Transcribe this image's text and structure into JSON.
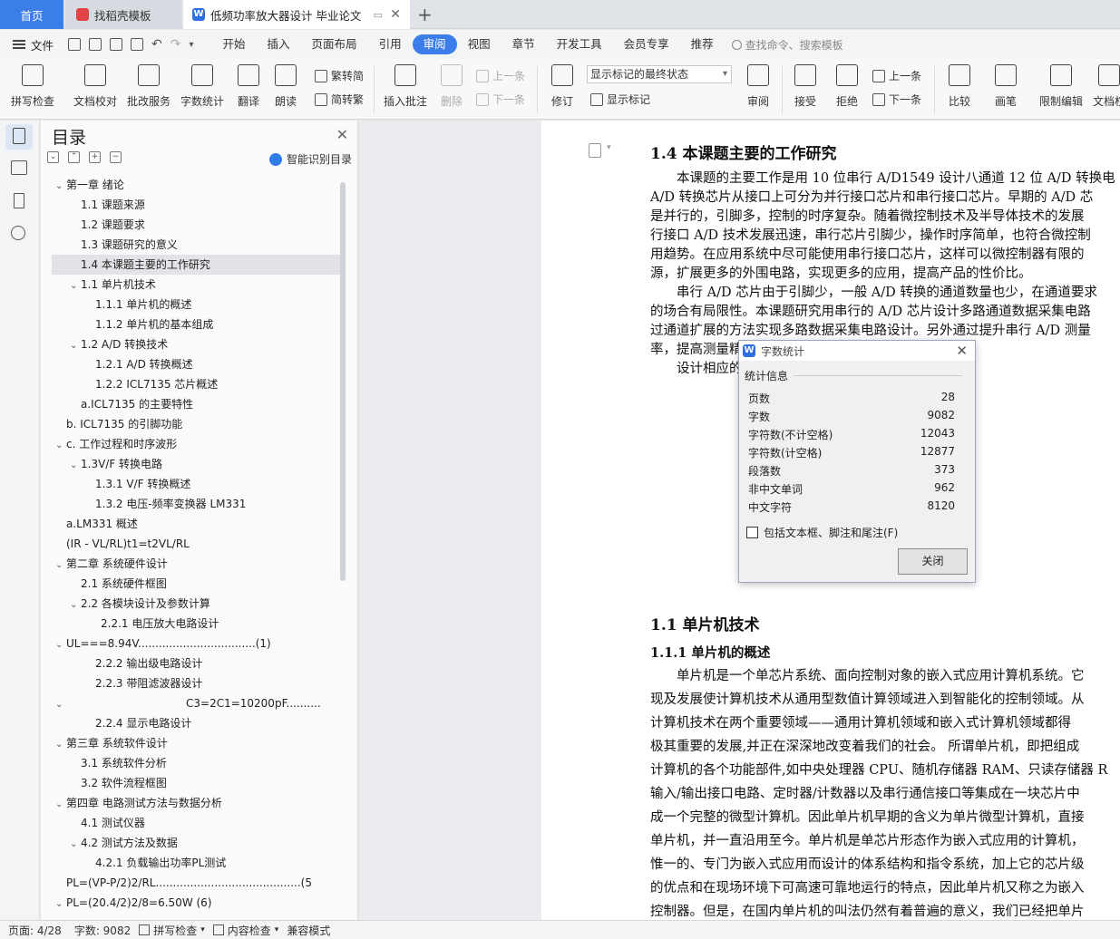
{
  "tabs": {
    "home": "首页",
    "template": "找稻壳模板",
    "doc": "低频功率放大器设计 毕业论文"
  },
  "menu": {
    "file": "文件",
    "items": [
      "开始",
      "插入",
      "页面布局",
      "引用",
      "审阅",
      "视图",
      "章节",
      "开发工具",
      "会员专享",
      "推荐"
    ],
    "active": "审阅",
    "search": "查找命令、搜索模板"
  },
  "ribbon": {
    "spell": "拼写检查",
    "doc_check": "文档校对",
    "review_service": "批改服务",
    "word_count": "字数统计",
    "translate": "翻译",
    "read": "朗读",
    "trad": "繁转简",
    "simp": "简转繁",
    "insert_comment": "插入批注",
    "delete": "删除",
    "prev": "上一条",
    "next": "下一条",
    "revise": "修订",
    "show_select": "显示标记的最终状态",
    "show_marks": "显示标记",
    "review": "审阅",
    "accept": "接受",
    "reject": "拒绝",
    "prev2": "上一条",
    "next2": "下一条",
    "compare": "比较",
    "pen": "画笔",
    "restrict": "限制编辑",
    "doc_perm": "文档权"
  },
  "toc": {
    "title": "目录",
    "smart": "智能识别目录",
    "items": [
      {
        "text": "第一章  绪论",
        "caret": "v"
      },
      {
        "text": "1.1 课题来源",
        "caret": ""
      },
      {
        "text": "1.2 课题要求",
        "caret": ""
      },
      {
        "text": "1.3 课题研究的意义",
        "caret": ""
      },
      {
        "text": "1.4 本课题主要的工作研究",
        "caret": ""
      },
      {
        "text": "1.1 单片机技术",
        "caret": "v"
      },
      {
        "text": "1.1.1 单片机的概述",
        "caret": ""
      },
      {
        "text": "1.1.2 单片机的基本组成",
        "caret": ""
      },
      {
        "text": "1.2 A/D 转换技术",
        "caret": "v"
      },
      {
        "text": "1.2.1 A/D 转换概述",
        "caret": ""
      },
      {
        "text": "1.2.2 ICL7135 芯片概述",
        "caret": ""
      },
      {
        "text": "a.ICL7135 的主要特性",
        "caret": ""
      },
      {
        "text": "b. ICL7135 的引脚功能",
        "caret": ""
      },
      {
        "text": "c.  工作过程和时序波形",
        "caret": "v"
      },
      {
        "text": "1.3V/F 转换电路",
        "caret": "v"
      },
      {
        "text": "1.3.1 V/F 转换概述",
        "caret": ""
      },
      {
        "text": "1.3.2  电压-频率变换器 LM331",
        "caret": ""
      },
      {
        "text": "a.LM331  概述",
        "caret": ""
      },
      {
        "text": "(IR - VL/RL)t1=t2VL/RL",
        "caret": ""
      },
      {
        "text": "第二章  系统硬件设计",
        "caret": "v"
      },
      {
        "text": "2.1  系统硬件框图",
        "caret": ""
      },
      {
        "text": "2.2  各模块设计及参数计算",
        "caret": "v"
      },
      {
        "text": "2.2.1  电压放大电路设计",
        "caret": ""
      },
      {
        "text": "UL===8.94V..................................(1)",
        "caret": "v"
      },
      {
        "text": "2.2.2  输出级电路设计",
        "caret": ""
      },
      {
        "text": "2.2.3  带阻滤波器设计",
        "caret": ""
      },
      {
        "text": "C3=2C1=10200pF..........",
        "caret": "v"
      },
      {
        "text": "2.2.4  显示电路设计",
        "caret": ""
      },
      {
        "text": "第三章    系统软件设计",
        "caret": "v"
      },
      {
        "text": "3.1  系统软件分析",
        "caret": ""
      },
      {
        "text": "3.2  软件流程框图",
        "caret": ""
      },
      {
        "text": "第四章    电路测试方法与数据分析",
        "caret": "v"
      },
      {
        "text": "4.1  测试仪器",
        "caret": ""
      },
      {
        "text": "4.2  测试方法及数据",
        "caret": "v"
      },
      {
        "text": "4.2.1  负载输出功率PL测试",
        "caret": ""
      },
      {
        "text": "PL=(VP-P/2)2/RL..........................................(5",
        "caret": ""
      },
      {
        "text": "PL=(20.4/2)2/8=6.50W                                (6)",
        "caret": "v"
      }
    ]
  },
  "doc": {
    "h_14": "1.4 本课题主要的工作研究",
    "p1": [
      "　　本课题的主要工作是用 10 位串行 A/D1549 设计八通道 12 位 A/D 转换电",
      "A/D 转换芯片从接口上可分为并行接口芯片和串行接口芯片。早期的 A/D 芯",
      "是并行的，引脚多，控制的时序复杂。随着微控制技术及半导体技术的发展",
      "行接口 A/D 技术发展迅速，串行芯片引脚少，操作时序简单，也符合微控制",
      "用趋势。在应用系统中尽可能使用串行接口芯片，这样可以微控制器有限的",
      "源，扩展更多的外围电路，实现更多的应用，提高产品的性价比。",
      "　　串行 A/D 芯片由于引脚少，一般 A/D 转换的通道数量也少，在通道要求",
      "的场合有局限性。本课题研究用串行的 A/D 芯片设计多路通道数据采集电路",
      "过通道扩展的方法实现多路数据采集电路设计。另外通过提升串行 A/D 测量",
      "率，提高测量精度",
      "　　设计相应的"
    ],
    "h_11": "1.1 单片机技术",
    "h_111": "1.1.1 单片机的概述",
    "p2": [
      "　　单片机是一个单芯片系统、面向控制对象的嵌入式应用计算机系统。它",
      "现及发展使计算机技术从通用型数值计算领域进入到智能化的控制领域。从",
      "计算机技术在两个重要领域——通用计算机领域和嵌入式计算机领域都得",
      "极其重要的发展,并正在深深地改变着我们的社会。 所谓单片机，即把组成",
      "计算机的各个功能部件,如中央处理器 CPU、随机存储器 RAM、只读存储器 R",
      "输入/输出接口电路、定时器/计数器以及串行通信接口等集成在一块芯片中",
      "成一个完整的微型计算机。因此单片机早期的含义为单片微型计算机，直接",
      "单片机，并一直沿用至今。单片机是单芯片形态作为嵌入式应用的计算机，",
      "惟一的、专门为嵌入式应用而设计的体系结构和指令系统，加上它的芯片级",
      "的优点和在现场环境下可高速可靠地运行的特点，因此单片机又称之为嵌入",
      "控制器。但是，在国内单片机的叫法仍然有着普遍的意义，我们已经把单片"
    ]
  },
  "dialog": {
    "title": "字数统计",
    "group": "统计信息",
    "stats": [
      {
        "label": "页数",
        "value": "28"
      },
      {
        "label": "字数",
        "value": "9082"
      },
      {
        "label": "字符数(不计空格)",
        "value": "12043"
      },
      {
        "label": "字符数(计空格)",
        "value": "12877"
      },
      {
        "label": "段落数",
        "value": "373"
      },
      {
        "label": "非中文单词",
        "value": "962"
      },
      {
        "label": "中文字符",
        "value": "8120"
      }
    ],
    "checkbox": "包括文本框、脚注和尾注(F)",
    "close": "关闭"
  },
  "status": {
    "page": "页面: 4/28",
    "words": "字数: 9082",
    "spell": "拼写检查",
    "content": "内容检查",
    "compat": "兼容模式"
  },
  "colors": {
    "accent": "#3b7de9"
  }
}
